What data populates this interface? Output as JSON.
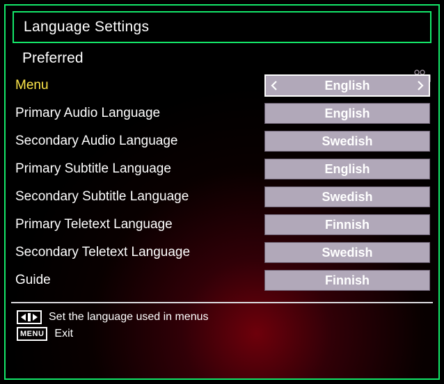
{
  "title": "Language Settings",
  "section": "Preferred",
  "items": [
    {
      "label": "Menu",
      "value": "English",
      "active": true
    },
    {
      "label": "Primary Audio Language",
      "value": "English",
      "active": false
    },
    {
      "label": "Secondary Audio Language",
      "value": "Swedish",
      "active": false
    },
    {
      "label": "Primary Subtitle Language",
      "value": "English",
      "active": false
    },
    {
      "label": "Secondary Subtitle Language",
      "value": "Swedish",
      "active": false
    },
    {
      "label": "Primary Teletext Language",
      "value": "Finnish",
      "active": false
    },
    {
      "label": "Secondary Teletext Language",
      "value": "Swedish",
      "active": false
    },
    {
      "label": "Guide",
      "value": "Finnish",
      "active": false
    }
  ],
  "hints": {
    "nav": "Set the language used in menus",
    "menu_word": "MENU",
    "menu": "Exit"
  }
}
